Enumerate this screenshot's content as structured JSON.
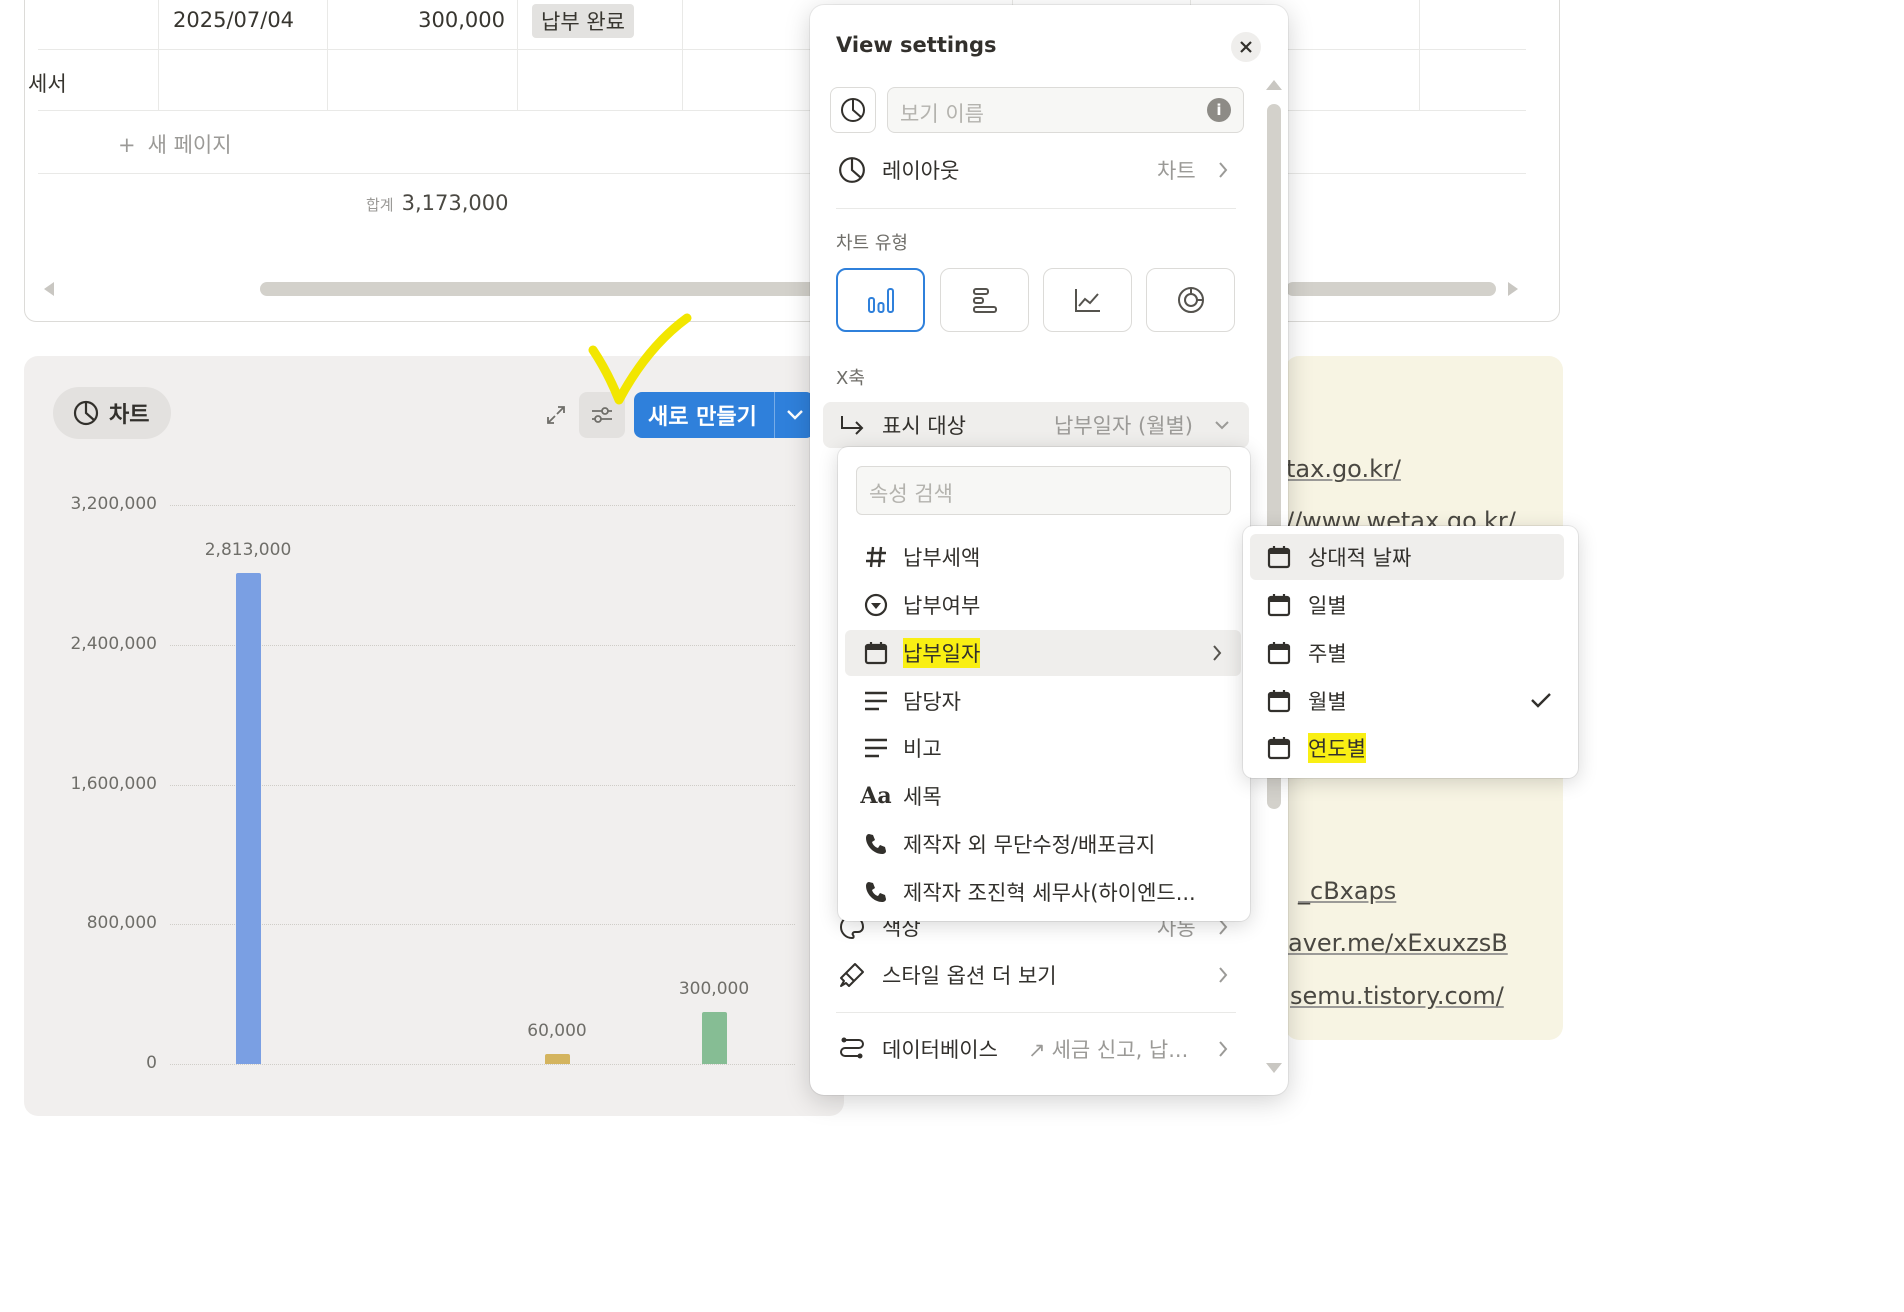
{
  "table": {
    "row1": {
      "date": "2025/07/04",
      "amount": "300,000",
      "status": "납부 완료"
    },
    "row2": {
      "title_fragment": "세서"
    },
    "new_page": "새 페이지",
    "sum_label": "합계",
    "sum_value": "3,173,000"
  },
  "chart_view": {
    "tab_label": "차트",
    "new_button": "새로 만들기"
  },
  "chart_data": {
    "type": "bar",
    "title": "",
    "xlabel": "",
    "ylabel": "",
    "ylim": [
      0,
      3200000
    ],
    "yticks": [
      "3,200,000",
      "2,400,000",
      "1,600,000",
      "800,000",
      "0"
    ],
    "grid": true,
    "bars": [
      {
        "value": 2813000,
        "label": "2,813,000",
        "color": "#7a9fe3"
      },
      {
        "value": 60000,
        "label": "60,000",
        "color": "#d4b45e"
      },
      {
        "value": 300000,
        "label": "300,000",
        "color": "#86bd94"
      }
    ]
  },
  "links": [
    "tax.go.kr/",
    "//www.wetax.go.kr/",
    "_cBxaps",
    "aver.me/xExuxzsB",
    "semu.tistory.com/"
  ],
  "view_settings": {
    "title": "View settings",
    "name_placeholder": "보기 이름",
    "layout_label": "레이아웃",
    "layout_value": "차트",
    "chart_type_label": "차트 유형",
    "x_axis_label": "X축",
    "display_label": "표시 대상",
    "display_value": "납부일자 (월별)",
    "color_label": "색상",
    "color_value": "자동",
    "more_style_label": "스타일 옵션 더 보기",
    "database_label": "데이터베이스",
    "database_value": "세금 신고, 납..."
  },
  "property_menu": {
    "search_placeholder": "속성 검색",
    "items": [
      {
        "label": "납부세액",
        "icon": "hash-icon"
      },
      {
        "label": "납부여부",
        "icon": "status-icon"
      },
      {
        "label": "납부일자",
        "icon": "calendar-icon"
      },
      {
        "label": "담당자",
        "icon": "text-icon"
      },
      {
        "label": "비고",
        "icon": "text-icon"
      },
      {
        "label": "세목",
        "icon": "title-icon"
      },
      {
        "label": "제작자 외 무단수정/배포금지",
        "icon": "phone-icon"
      },
      {
        "label": "제작자 조진혁 세무사(하이엔드...",
        "icon": "phone-icon"
      }
    ],
    "title_icon_glyph": "Aa"
  },
  "date_menu": {
    "items": [
      {
        "label": "상대적 날짜"
      },
      {
        "label": "일별"
      },
      {
        "label": "주별"
      },
      {
        "label": "월별",
        "checked": true
      },
      {
        "label": "연도별"
      }
    ]
  },
  "colors": {
    "accent": "#2f80db",
    "highlight": "#f9ef13",
    "annotation_check": "#f2e600"
  }
}
